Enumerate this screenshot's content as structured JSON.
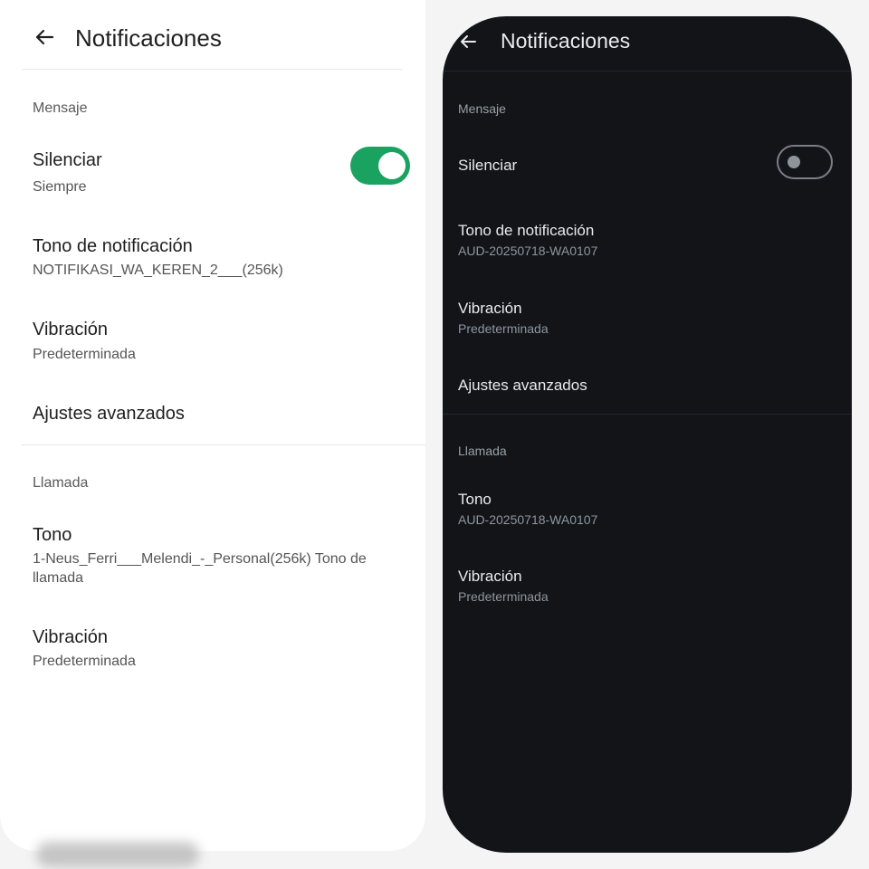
{
  "light": {
    "header": {
      "title": "Notificaciones"
    },
    "message_section": {
      "label": "Mensaje",
      "mute": {
        "title": "Silenciar",
        "value": "Siempre",
        "enabled": true
      },
      "tone": {
        "title": "Tono de notificación",
        "value": "NOTIFIKASI_WA_KEREN_2___(256k)"
      },
      "vibration": {
        "title": "Vibración",
        "value": "Predeterminada"
      },
      "advanced": {
        "title": "Ajustes avanzados"
      }
    },
    "call_section": {
      "label": "Llamada",
      "tone": {
        "title": "Tono",
        "value": "1-Neus_Ferri___Melendi_-_Personal(256k) Tono de llamada"
      },
      "vibration": {
        "title": "Vibración",
        "value": "Predeterminada"
      }
    }
  },
  "dark": {
    "header": {
      "title": "Notificaciones"
    },
    "message_section": {
      "label": "Mensaje",
      "mute": {
        "title": "Silenciar",
        "enabled": false
      },
      "tone": {
        "title": "Tono de notificación",
        "value": "AUD-20250718-WA0107"
      },
      "vibration": {
        "title": "Vibración",
        "value": "Predeterminada"
      },
      "advanced": {
        "title": "Ajustes avanzados"
      }
    },
    "call_section": {
      "label": "Llamada",
      "tone": {
        "title": "Tono",
        "value": "AUD-20250718-WA0107"
      },
      "vibration": {
        "title": "Vibración",
        "value": "Predeterminada"
      }
    }
  },
  "colors": {
    "toggle_on": "#1aa260",
    "dark_background": "#121418",
    "light_background": "#ffffff"
  },
  "icons": [
    "back-arrow-icon"
  ]
}
